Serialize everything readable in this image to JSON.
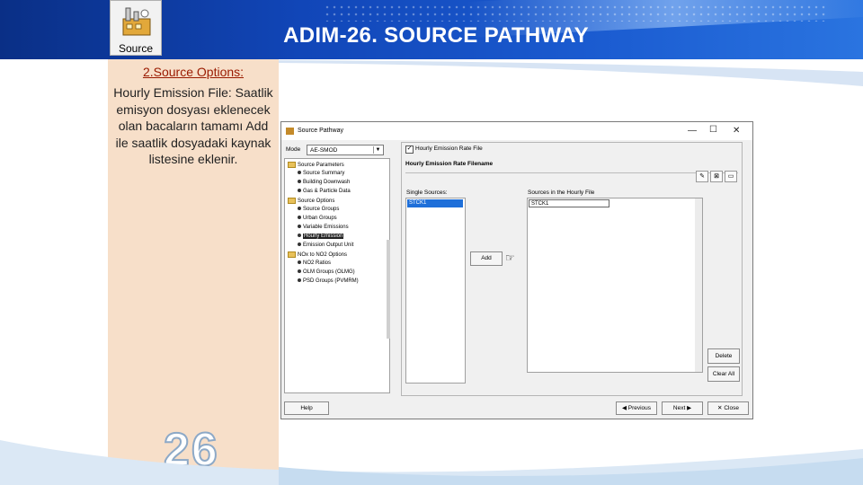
{
  "slide": {
    "title": "ADIM-26. SOURCE PATHWAY",
    "logo_label": "Source",
    "section_title": "2.Source Options:",
    "body_text": "Hourly Emission File: Saatlik emisyon dosyası eklenecek olan bacaların tamamı Add ile saatlik dosyadaki kaynak listesine eklenir.",
    "slide_number": "26",
    "colors": {
      "header": "#1146b8",
      "panel": "#f7dfc9",
      "section_title": "#9a1a00"
    }
  },
  "window": {
    "title": "Source Pathway",
    "mode_label": "Mode",
    "mode_value": "AE-SMOD",
    "tree": [
      {
        "label": "Source Parameters",
        "type": "folder"
      },
      {
        "label": "Source Summary",
        "type": "item"
      },
      {
        "label": "Building Downwash",
        "type": "item"
      },
      {
        "label": "Gas & Particle Data",
        "type": "item"
      },
      {
        "label": "Source Options",
        "type": "folder"
      },
      {
        "label": "Source Groups",
        "type": "item"
      },
      {
        "label": "Urban Groups",
        "type": "item"
      },
      {
        "label": "Variable Emissions",
        "type": "item"
      },
      {
        "label": "Hourly Emission",
        "type": "item-selected"
      },
      {
        "label": "Emission Output Unit",
        "type": "item"
      },
      {
        "label": "NOx to NO2 Options",
        "type": "folder"
      },
      {
        "label": "NO2 Ratios",
        "type": "item"
      },
      {
        "label": "OLM Groups (OLMG)",
        "type": "item"
      },
      {
        "label": "PSD Groups (PVMRM)",
        "type": "item"
      }
    ],
    "hourly_checkbox_label": "Hourly Emission Rate File",
    "filename_label": "Hourly Emission Rate Filename",
    "single_sources_label": "Single Sources:",
    "single_sources": [
      "STCK1"
    ],
    "hourly_sources_label": "Sources in the Hourly File",
    "hourly_sources": [
      "STCK1"
    ],
    "add_label": "Add",
    "delete_label": "Delete",
    "clear_all_label": "Clear All",
    "help_label": "Help",
    "previous_label": "Previous",
    "next_label": "Next",
    "close_label": "Close"
  }
}
